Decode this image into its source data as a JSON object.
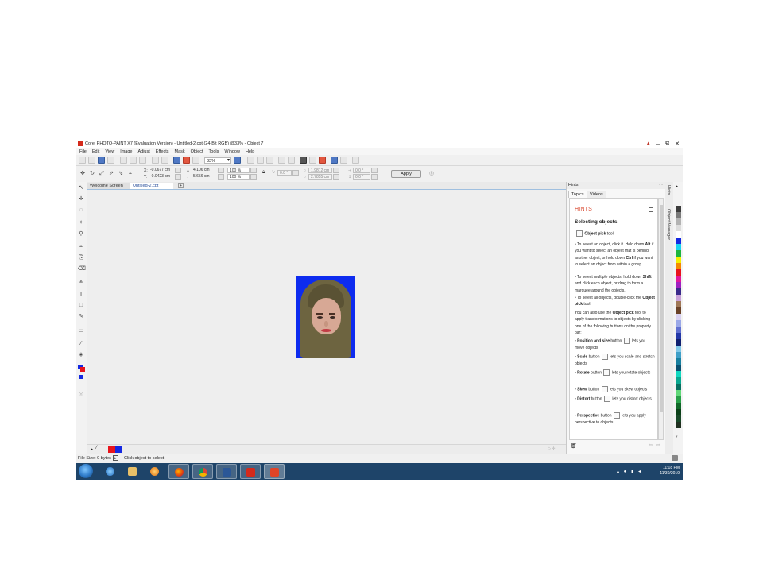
{
  "window": {
    "title": "Corel PHOTO-PAINT X7 (Evaluation Version) - Untitled-2.cpt (24-Bit RGB) @33% - Object 7",
    "controls": [
      "▲",
      "–",
      "⧉",
      "✕"
    ]
  },
  "menu": [
    "File",
    "Edit",
    "View",
    "Image",
    "Adjust",
    "Effects",
    "Mask",
    "Object",
    "Tools",
    "Window",
    "Help"
  ],
  "toolbar": {
    "zoom_value": "33%"
  },
  "property_bar": {
    "x_label": "X:",
    "x_value": "-0.0677 cm",
    "y_label": "Y:",
    "y_value": "-0.0423 cm",
    "width_value": "4.106 cm",
    "height_value": "5.656 cm",
    "scale_w": "100 %",
    "scale_h": "100 %",
    "rotate_value": "0.0 °",
    "center_x": "1.9812 cm",
    "center_y": "2.7855 cm",
    "skew_h": "0.0 °",
    "skew_v": "0.0 °",
    "apply_label": "Apply"
  },
  "doc_tabs": [
    {
      "label": "Welcome Screen",
      "active": false
    },
    {
      "label": "Untitled-2.cpt",
      "active": true
    }
  ],
  "tab_add_label": "+",
  "hints_panel": {
    "panel_title": "Hints",
    "tabs": [
      "Topics",
      "Videos"
    ],
    "heading": "HINTS",
    "title": "Selecting objects",
    "tool_name": "Object pick",
    "tool_suffix": "tool",
    "p1_a": "• To select an object, click it. Hold down",
    "p1_b": "Alt",
    "p1_c": "if you want to select an object that is behind another object, or hold down",
    "p1_d": "Ctrl",
    "p1_e": "if you want to select an object from within a group.",
    "p2_a": "• To select multiple objects, hold down",
    "p2_b": "Shift",
    "p2_c": "and click each object, or drag to form a marquee around the objects.",
    "p3_a": "• To select all objects, double-click the",
    "p3_b": "Object pick",
    "p3_c": "tool.",
    "p4_a": "You can also use the",
    "p4_b": "Object pick",
    "p4_c": "tool to apply transformations to objects by clicking one of the following buttons on the property bar:",
    "items": [
      {
        "name": "Position and size",
        "text": "lets you move objects"
      },
      {
        "name": "Scale",
        "text": "lets you scale and stretch objects"
      },
      {
        "name": "Rotate",
        "text": "lets you rotate objects"
      },
      {
        "name": "Skew",
        "text": "lets you skew objects"
      },
      {
        "name": "Distort",
        "text": "lets you distort objects"
      },
      {
        "name": "Perspective",
        "text": "lets you apply perspective to objects"
      }
    ],
    "button_word": "button"
  },
  "dock_tabs": [
    "Hints",
    "Object Manager"
  ],
  "status_bar": {
    "file_size": "File Size: 0 bytes",
    "message": "Click object to select"
  },
  "taskbar": {
    "time": "11:18 PM",
    "date": "11/30/2019"
  },
  "colors": {
    "accent_red": "#d8452c",
    "photo_background": "#0d2bef",
    "taskbar": "#1e4469"
  }
}
